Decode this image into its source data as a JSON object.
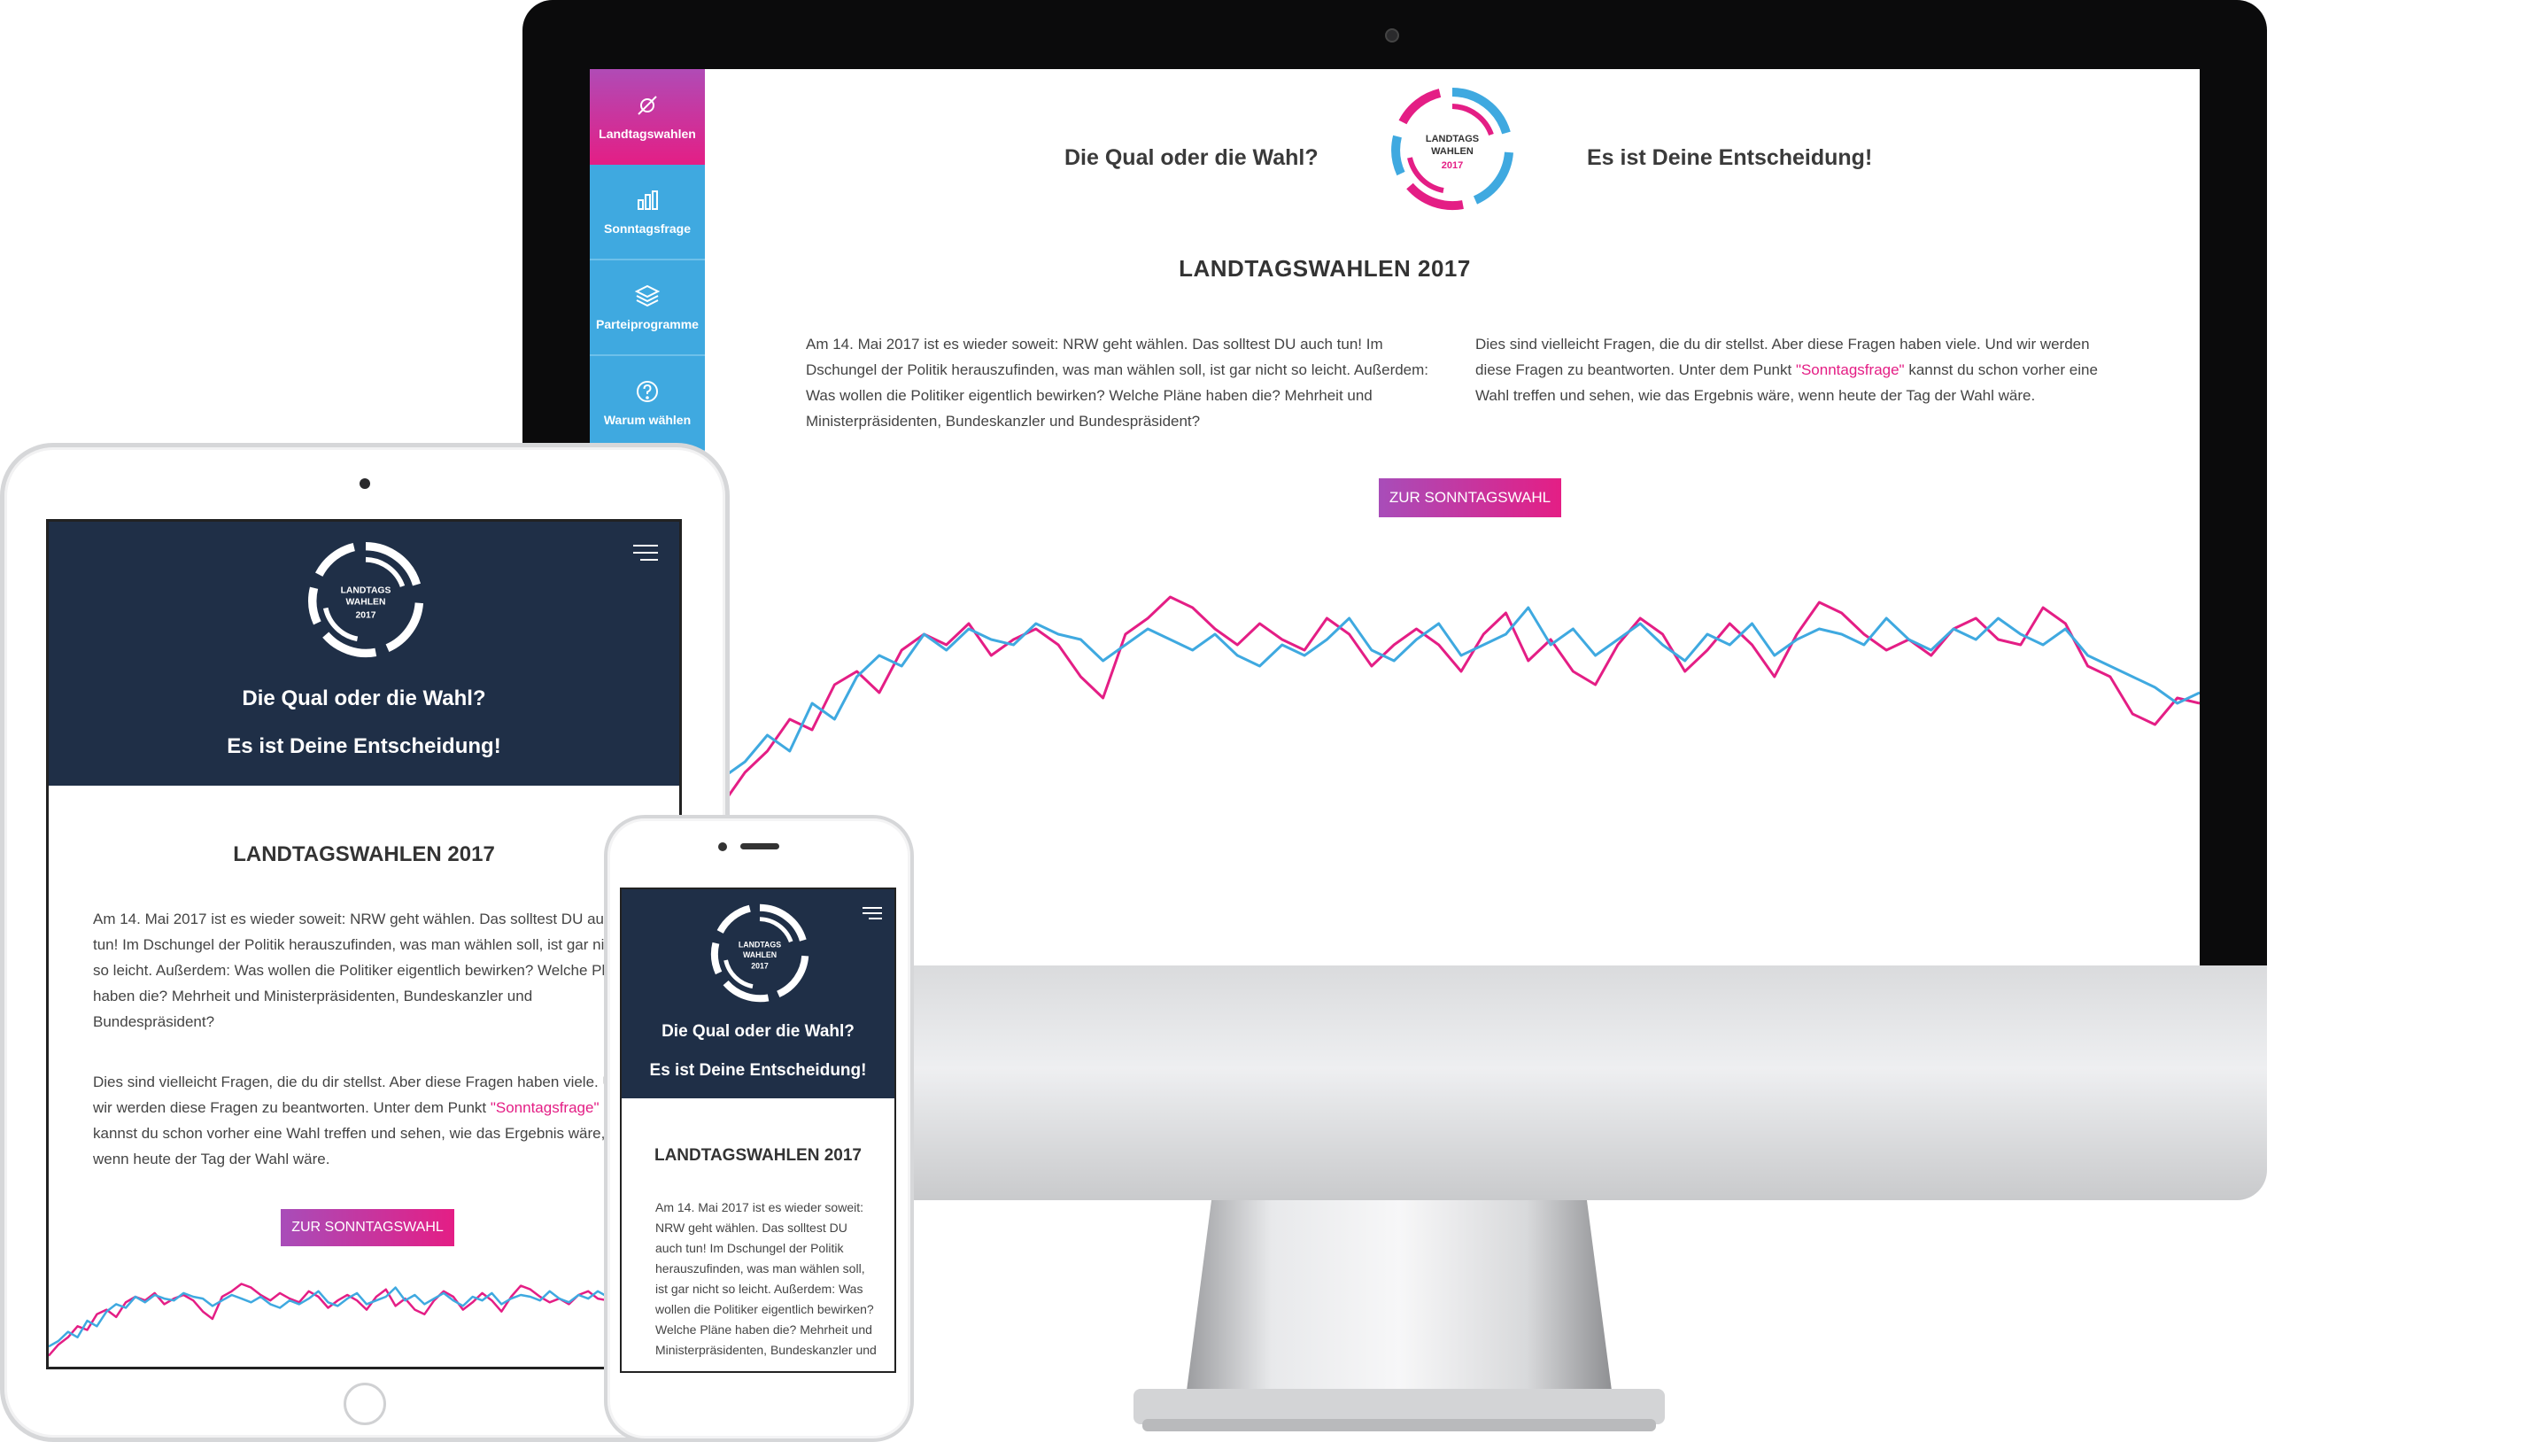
{
  "brand": {
    "accent_pink": "#e41e85",
    "accent_purple": "#a84db9",
    "accent_blue": "#3fa9e0",
    "navy": "#1f2f47"
  },
  "logo": {
    "line1": "LANDTAGS",
    "line2": "WAHLEN",
    "line3": "2017"
  },
  "sidebar": {
    "items": [
      {
        "label": "Landtagswahlen",
        "icon": "ballot-icon",
        "active": true
      },
      {
        "label": "Sonntagsfrage",
        "icon": "bar-chart-icon",
        "active": false
      },
      {
        "label": "Parteiprogramme",
        "icon": "layers-icon",
        "active": false
      },
      {
        "label": "Warum wählen",
        "icon": "question-icon",
        "active": false
      }
    ]
  },
  "header": {
    "tagline_left": "Die Qual oder die Wahl?",
    "tagline_right": "Es ist Deine Entscheidung!"
  },
  "content": {
    "title": "LANDTAGSWAHLEN 2017",
    "paragraph1": "Am 14. Mai 2017 ist es wieder soweit: NRW geht wählen. Das solltest DU auch tun! Im Dschungel der Politik herauszufinden, was man wählen soll, ist gar nicht so leicht. Außerdem: Was wollen die Politiker eigentlich bewirken? Welche Pläne haben die? Mehrheit und Ministerpräsidenten, Bundeskanzler und Bundespräsident?",
    "paragraph2_before": "Dies sind vielleicht Fragen, die du dir stellst. Aber diese Fragen haben viele. Und wir werden diese Fragen zu beantworten. Unter dem Punkt ",
    "paragraph2_link": "\"Sonntagsfrage\"",
    "paragraph2_after": " kannst du schon vorher eine Wahl treffen und sehen, wie das Ergebnis wäre, wenn heute der Tag der Wahl wäre.",
    "cta_label": "ZUR SONNTAGSWAHL",
    "mobile_paragraph1_excerpt": "Am 14. Mai 2017 ist es wieder soweit: NRW geht wählen. Das solltest DU auch tun! Im Dschungel der Politik herauszufinden, was man wählen soll, ist gar nicht so leicht. Außerdem: Was wollen die Politiker eigentlich bewirken? Welche Pläne haben die? Mehrheit und Ministerpräsidenten, Bundeskanzler und"
  },
  "decorative_chart": {
    "series": [
      {
        "color": "#e41e85",
        "values": [
          10,
          22,
          30,
          42,
          38,
          55,
          60,
          52,
          68,
          74,
          70,
          78,
          66,
          72,
          76,
          70,
          58,
          50,
          74,
          80,
          88,
          84,
          76,
          70,
          78,
          72,
          68,
          80,
          74,
          62,
          70,
          76,
          70,
          60,
          74,
          82,
          64,
          72,
          60,
          55,
          70,
          80,
          74,
          60,
          68,
          78,
          70,
          58,
          74,
          86,
          82,
          74,
          68,
          72,
          66,
          76,
          80,
          72,
          70,
          84,
          78,
          62,
          58,
          44,
          40,
          50,
          48
        ]
      },
      {
        "color": "#3fa9e0",
        "values": [
          20,
          26,
          36,
          30,
          48,
          42,
          58,
          66,
          62,
          74,
          68,
          76,
          72,
          70,
          78,
          74,
          72,
          64,
          70,
          76,
          72,
          68,
          74,
          66,
          62,
          70,
          66,
          72,
          80,
          68,
          64,
          72,
          78,
          66,
          70,
          74,
          84,
          70,
          76,
          66,
          72,
          78,
          70,
          64,
          74,
          70,
          78,
          66,
          72,
          76,
          74,
          70,
          80,
          72,
          68,
          76,
          72,
          80,
          74,
          70,
          76,
          66,
          62,
          58,
          54,
          48,
          52
        ]
      }
    ]
  }
}
